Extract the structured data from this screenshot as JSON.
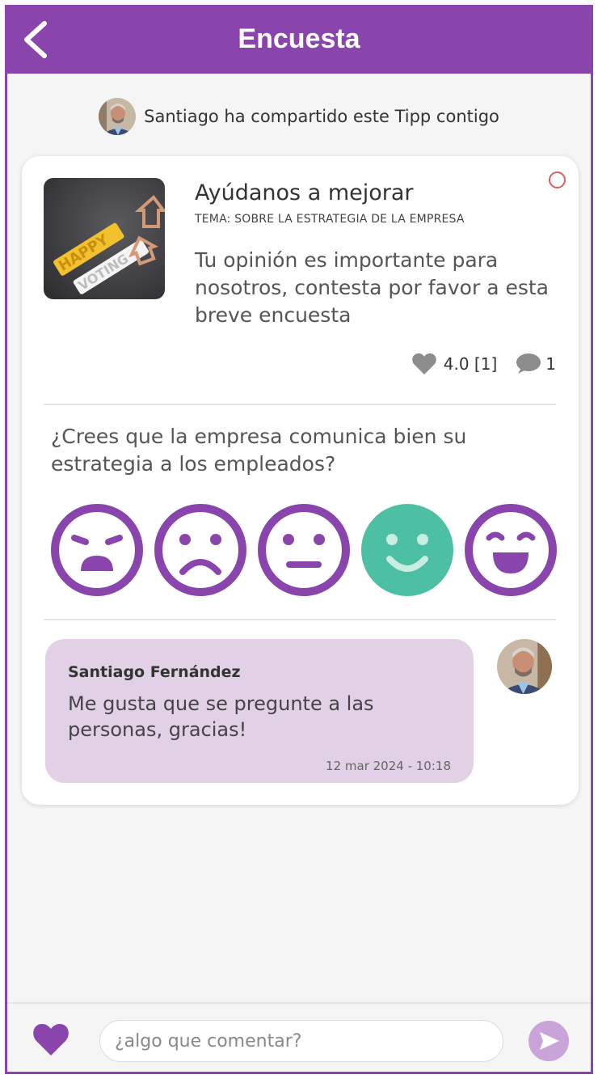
{
  "header": {
    "title": "Encuesta"
  },
  "shared": {
    "text": "Santiago ha compartido este Tipp contigo"
  },
  "tipp": {
    "title": "Ayúdanos a mejorar",
    "topic": "TEMA: SOBRE LA ESTRATEGIA DE LA EMPRESA",
    "description": "Tu opinión es importante para nosotros, contesta por favor a esta breve encuesta",
    "rating": "4.0 [1]",
    "comments_count": "1",
    "image_text": "HAPPY VOTING"
  },
  "survey": {
    "question": "¿Crees que la empresa comunica bien su estrategia a los empleados?",
    "selected_index": 3
  },
  "comment": {
    "author": "Santiago Fernández",
    "text": "Me gusta que se pregunte a las personas, gracias!",
    "timestamp": "12 mar 2024 - 10:18"
  },
  "footer": {
    "placeholder": "¿algo que comentar?"
  },
  "colors": {
    "brand": "#8a45ad",
    "selected_face": "#4dbfa3",
    "bubble": "#e1d0e6",
    "send": "#c9a4d8"
  }
}
